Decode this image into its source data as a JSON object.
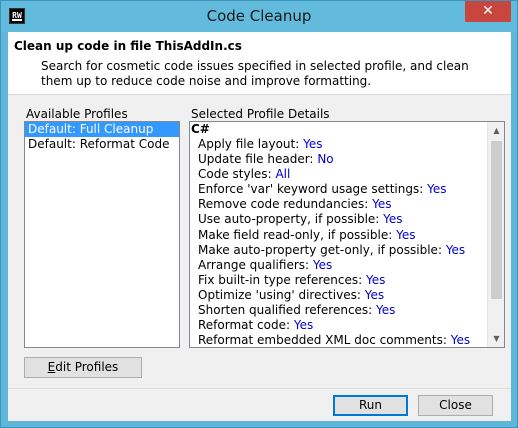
{
  "window": {
    "title": "Code Cleanup",
    "close_glyph": "✕",
    "icon_label": "RW"
  },
  "header": {
    "title": "Clean up code in file ThisAddIn.cs",
    "description": "Search for cosmetic code issues specified in selected profile, and clean them up to reduce code noise and improve formatting."
  },
  "profiles": {
    "label": "Available Profiles",
    "items": [
      {
        "label": "Default: Full Cleanup",
        "selected": true
      },
      {
        "label": "Default: Reformat Code",
        "selected": false
      }
    ]
  },
  "details": {
    "label": "Selected Profile Details",
    "section": "C#",
    "rows": [
      {
        "label": "Apply file layout:",
        "value": "Yes"
      },
      {
        "label": "Update file header:",
        "value": "No"
      },
      {
        "label": "Code styles:",
        "value": "All"
      },
      {
        "label": "Enforce 'var' keyword usage settings:",
        "value": "Yes"
      },
      {
        "label": "Remove code redundancies:",
        "value": "Yes"
      },
      {
        "label": "Use auto-property, if possible:",
        "value": "Yes"
      },
      {
        "label": "Make field read-only, if possible:",
        "value": "Yes"
      },
      {
        "label": "Make auto-property get-only, if possible:",
        "value": "Yes"
      },
      {
        "label": "Arrange qualifiers:",
        "value": "Yes"
      },
      {
        "label": "Fix built-in type references:",
        "value": "Yes"
      },
      {
        "label": "Optimize 'using' directives:",
        "value": "Yes"
      },
      {
        "label": "Shorten qualified references:",
        "value": "Yes"
      },
      {
        "label": "Reformat code:",
        "value": "Yes"
      },
      {
        "label": "Reformat embedded XML doc comments:",
        "value": "Yes"
      }
    ],
    "scroll_up_glyph": "▲",
    "scroll_down_glyph": "▼"
  },
  "buttons": {
    "edit_profiles_mnemonic": "E",
    "edit_profiles_rest": "dit Profiles",
    "run": "Run",
    "close": "Close"
  }
}
